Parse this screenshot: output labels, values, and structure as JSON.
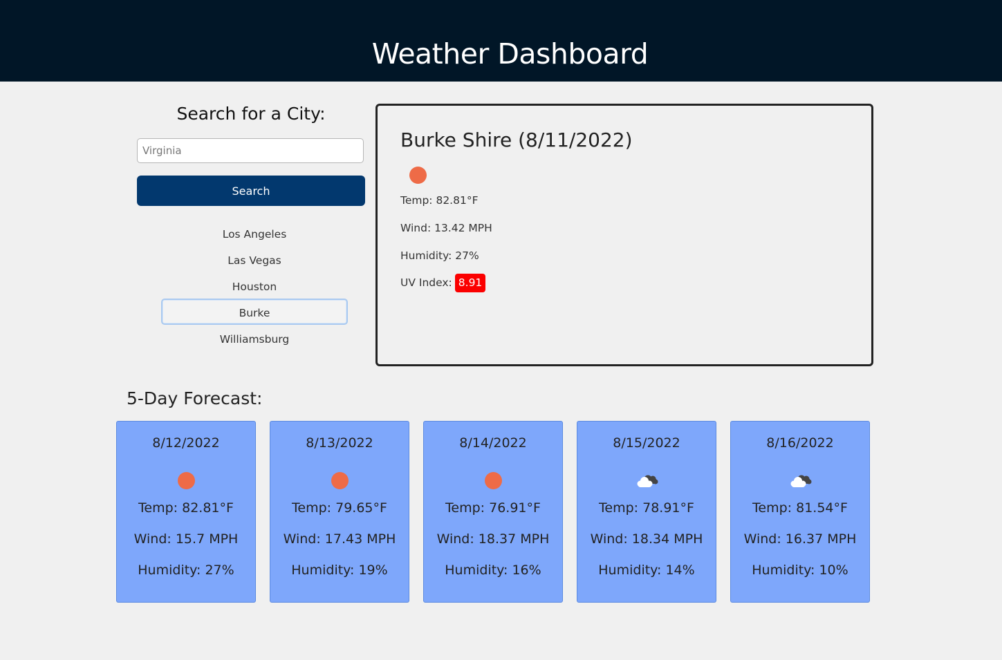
{
  "header": {
    "title": "Weather Dashboard"
  },
  "search": {
    "title": "Search for a City:",
    "input_value": "",
    "placeholder": "Virginia",
    "button_label": "Search",
    "history": [
      "Los Angeles",
      "Las Vegas",
      "Houston",
      "Burke",
      "Williamsburg"
    ],
    "active_history_item": "Burke"
  },
  "current": {
    "title": "Burke Shire (8/11/2022)",
    "icon": "sun-icon",
    "temp": "Temp: 82.81°F",
    "wind": "Wind: 13.42 MPH",
    "humidity": "Humidity: 27%",
    "uv_label": "UV Index:",
    "uv_value": "8.91",
    "uv_color": "#fb0000"
  },
  "forecast": {
    "title": "5-Day Forecast:",
    "days": [
      {
        "date": "8/12/2022",
        "icon": "sun-icon",
        "temp": "Temp: 82.81°F",
        "wind": "Wind: 15.7 MPH",
        "humidity": "Humidity: 27%"
      },
      {
        "date": "8/13/2022",
        "icon": "sun-icon",
        "temp": "Temp: 79.65°F",
        "wind": "Wind: 17.43 MPH",
        "humidity": "Humidity: 19%"
      },
      {
        "date": "8/14/2022",
        "icon": "sun-icon",
        "temp": "Temp: 76.91°F",
        "wind": "Wind: 18.37 MPH",
        "humidity": "Humidity: 16%"
      },
      {
        "date": "8/15/2022",
        "icon": "clouds-icon",
        "temp": "Temp: 78.91°F",
        "wind": "Wind: 18.34 MPH",
        "humidity": "Humidity: 14%"
      },
      {
        "date": "8/16/2022",
        "icon": "clouds-icon",
        "temp": "Temp: 81.54°F",
        "wind": "Wind: 16.37 MPH",
        "humidity": "Humidity: 10%"
      }
    ]
  },
  "colors": {
    "header_bg": "#011627",
    "button_bg": "#02386e",
    "forecast_card_bg": "#7ea7fb",
    "sun": "#ee6b47"
  }
}
